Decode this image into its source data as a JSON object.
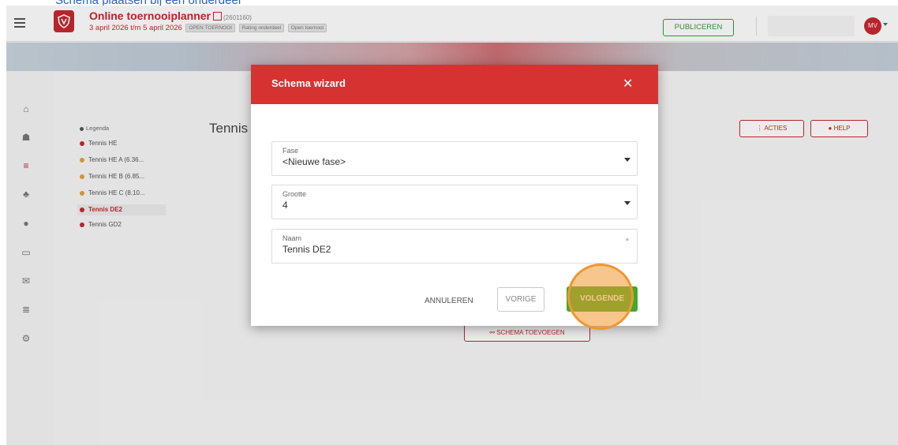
{
  "top_caption": "Schema plaatsen bij een onderdeel",
  "header": {
    "app_title": "Online toernooiplanner",
    "app_id": "(2601160)",
    "date_range": "3 april 2026 t/m 5 april 2026",
    "tags": [
      "OPEN TOERNOOI",
      "Rating onderdeel",
      "Open toernooi"
    ],
    "publish_label": "PUBLICEREN",
    "avatar_initials": "MV"
  },
  "sidebar": {
    "icons": [
      "home-icon",
      "users-icon",
      "list-icon",
      "hierarchy-icon",
      "ball-icon",
      "monitor-icon",
      "mail-icon",
      "stack-icon",
      "gear-icon"
    ]
  },
  "legend": {
    "title": "Legenda",
    "items": [
      {
        "label": "Tennis HE",
        "color": "#c8282f"
      },
      {
        "label": "Tennis HE A (6.36...",
        "color": "#e6a13a"
      },
      {
        "label": "Tennis HE B (6.85...",
        "color": "#e6a13a"
      },
      {
        "label": "Tennis HE C (8.10...",
        "color": "#e6a13a"
      },
      {
        "label": "Tennis DE2",
        "color": "#c8282f"
      },
      {
        "label": "Tennis GD2",
        "color": "#c8282f"
      }
    ]
  },
  "main": {
    "heading": "Tennis",
    "acties_label": "ACTIES",
    "help_label": "HELP",
    "schema_add_label": "SCHEMA TOEVOEGEN"
  },
  "modal": {
    "title": "Schema wizard",
    "close_symbol": "✕",
    "fields": {
      "fase": {
        "label": "Fase",
        "value": "<Nieuwe fase>"
      },
      "grootte": {
        "label": "Grootte",
        "value": "4"
      },
      "naam": {
        "label": "Naam",
        "value": "Tennis DE2",
        "required_marker": "*"
      }
    },
    "buttons": {
      "cancel": "ANNULEREN",
      "previous": "VORIGE",
      "next": "VOLGENDE"
    }
  },
  "colors": {
    "brand": "#c8282f",
    "modal_header": "#d73232",
    "next_button": "#3faa2f",
    "highlight": "#f0972f"
  }
}
